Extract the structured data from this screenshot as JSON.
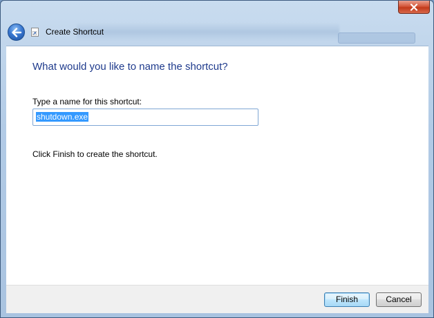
{
  "window": {
    "title": "Create Shortcut",
    "close_icon": "close-icon",
    "back_icon": "back-arrow-icon",
    "title_icon": "shortcut-icon"
  },
  "content": {
    "heading": "What would you like to name the shortcut?",
    "name_label": "Type a name for this shortcut:",
    "name_value": "shutdown.exe",
    "instruction": "Click Finish to create the shortcut."
  },
  "footer": {
    "finish_label": "Finish",
    "cancel_label": "Cancel"
  },
  "colors": {
    "heading": "#1e3a8c",
    "selection": "#3399ff",
    "close_button": "#c23a1b",
    "frame": "#b2cbe6"
  }
}
